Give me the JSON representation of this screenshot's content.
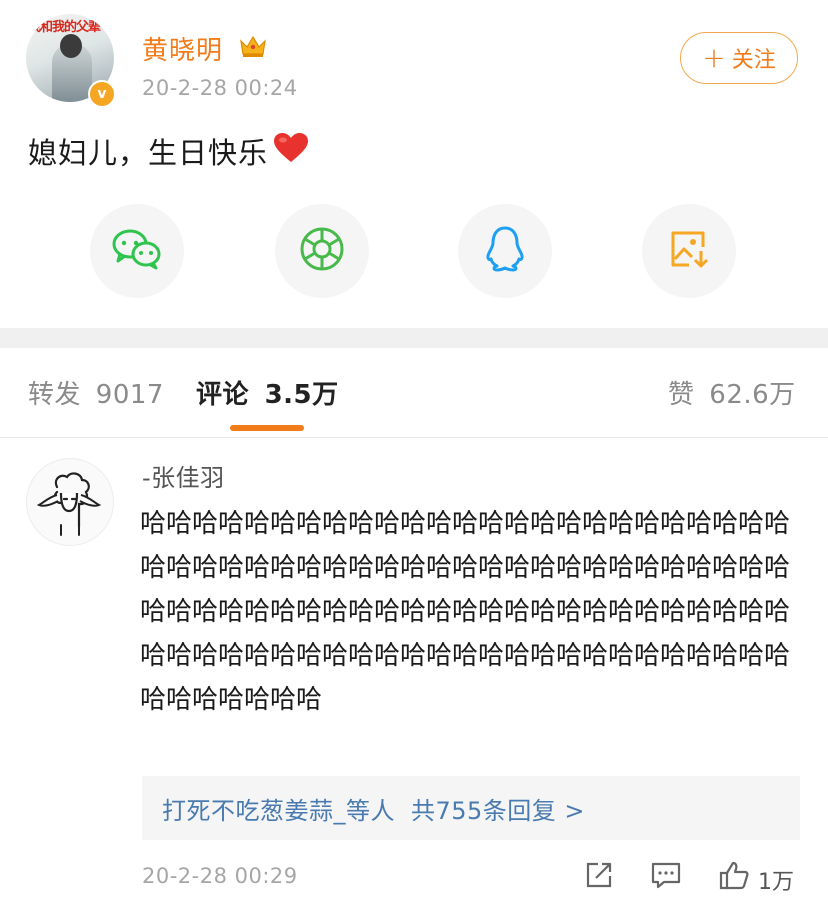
{
  "post": {
    "author": "黄晓明",
    "time": "20-2-28 00:24",
    "follow_label": "关注",
    "text": "媳妇儿，生日快乐",
    "avatar_banner": "我和我的父辈"
  },
  "share": {
    "items": [
      {
        "name": "wechat-icon",
        "color": "#2ec44d"
      },
      {
        "name": "moments-icon",
        "color": "#48b94b"
      },
      {
        "name": "qq-icon",
        "color": "#1ea0f0"
      },
      {
        "name": "save-image-icon",
        "color": "#f5a623"
      }
    ]
  },
  "tabs": {
    "repost_label": "转发",
    "repost_count": "9017",
    "comment_label": "评论",
    "comment_count": "3.5万",
    "like_label": "赞",
    "like_count": "62.6万"
  },
  "comment": {
    "author": "-张佳羽",
    "text": "哈哈哈哈哈哈哈哈哈哈哈哈哈哈哈哈哈哈哈哈哈哈哈哈哈哈哈哈哈哈哈哈哈哈哈哈哈哈哈哈哈哈哈哈哈哈哈哈哈哈哈哈哈哈哈哈哈哈哈哈哈哈哈哈哈哈哈哈哈哈哈哈哈哈哈哈哈哈哈哈哈哈哈哈哈哈哈哈哈哈哈哈哈哈哈哈哈哈哈哈哈哈哈哈哈哈哈",
    "reply_user": "打死不吃葱姜蒜_等人",
    "reply_summary": "共755条回复 >",
    "time": "20-2-28 00:29",
    "like_count": "1万"
  },
  "colors": {
    "accent": "#f27b1a",
    "link": "#4a7bb0",
    "muted": "#a6a6a6"
  }
}
